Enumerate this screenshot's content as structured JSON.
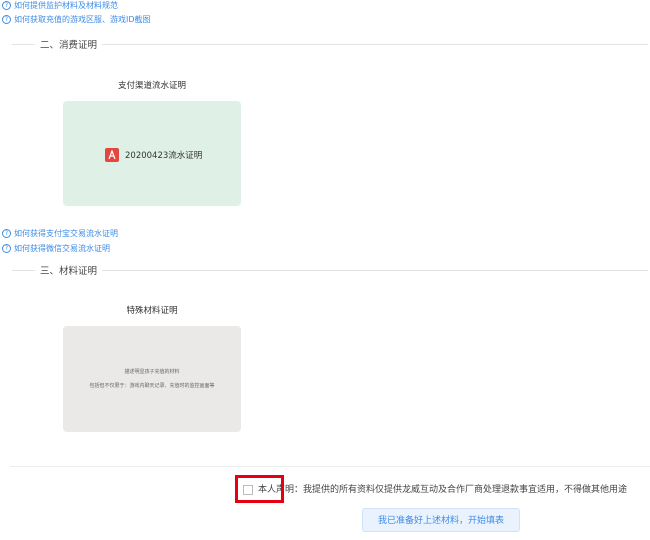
{
  "help_links_top": [
    "如何提供监护材料及材料规范",
    "如何获取充值的游戏区服、游戏ID截图"
  ],
  "sections": {
    "consumption": {
      "title": "二、消费证明",
      "card_title": "支付渠道流水证明",
      "file_name": "20200423流水证明"
    },
    "material": {
      "title": "三、材料证明",
      "card_title": "特殊材料证明",
      "sample_line1": "描述明显孩子充值的材料",
      "sample_line2": "包括但不仅限于：游戏内聊天记录、充值时的监控画面等"
    }
  },
  "help_links_mid": [
    "如何获得支付宝交易流水证明",
    "如何获得微信交易流水证明"
  ],
  "footer": {
    "agreement": "本人声明：我提供的所有资料仅提供龙威互动及合作厂商处理退款事宜适用，不得做其他用途",
    "start_button": "我已准备好上述材料，开始填表"
  },
  "colors": {
    "link": "#3d8be6",
    "green_card": "#dff1e7",
    "gray_card": "#ebe8e8",
    "highlight": "#e60012",
    "pdf_icon": "#e4473f"
  }
}
